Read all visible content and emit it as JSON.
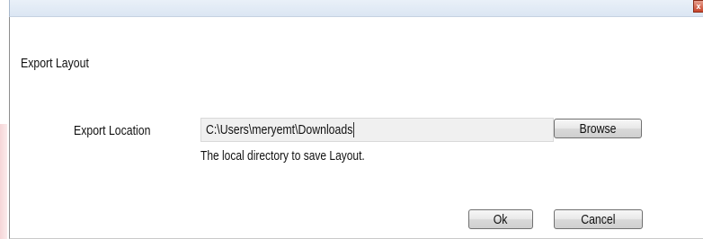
{
  "window": {
    "close_glyph": "x"
  },
  "dialog": {
    "title": "Export Layout",
    "location_label": "Export Location",
    "location_value": "C:\\Users\\meryemt\\Downloads",
    "hint": "The local directory to save Layout.",
    "browse_label": "Browse",
    "ok_label": "Ok",
    "cancel_label": "Cancel"
  },
  "colors": {
    "titlebar": "#dbe6f3",
    "input_background": "#f0f0f0",
    "close_button": "#c8442a"
  }
}
